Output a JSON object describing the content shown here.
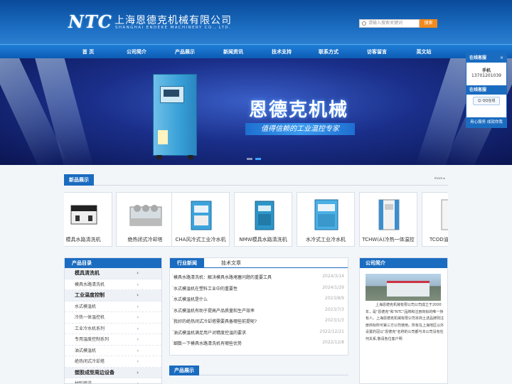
{
  "header": {
    "logo": "NTC",
    "company_cn": "上海恩德克机械有限公司",
    "company_en": "SHANGHAI ENDEKE MACHINERY CO., LTD.",
    "search_placeholder": "请输入搜索关键词",
    "search_button": "搜索"
  },
  "nav": [
    "首 页",
    "公司简介",
    "产品展示",
    "新闻资讯",
    "技术支持",
    "联系方式",
    "访客留言",
    "英文站"
  ],
  "banner": {
    "title": "恩德克机械",
    "subtitle": "值得信赖的工业温控专家"
  },
  "products_section": {
    "title": "新品展示",
    "more": "more ▸",
    "items": [
      "模具水路清洗机",
      "绝热闭式冷却塔",
      "CHA风冷式工业冷水机",
      "NMW模具水路清洗机",
      "水冷式工业冷水机",
      "TCHW(A)冷热一体温控",
      "TCOD油"
    ]
  },
  "sidebar": {
    "title": "产品目录",
    "items": [
      {
        "label": "模具清洗机",
        "cat": true
      },
      {
        "label": "模具水路清洗机",
        "cat": false
      },
      {
        "label": "工业温度控制",
        "cat": true
      },
      {
        "label": "水式模温机",
        "cat": false
      },
      {
        "label": "冷热一体温控机",
        "cat": false
      },
      {
        "label": "工业冷水机系列",
        "cat": false
      },
      {
        "label": "专用温度控制系列",
        "cat": false
      },
      {
        "label": "油式模温机",
        "cat": false
      },
      {
        "label": "绝热闭式冷却塔",
        "cat": false
      },
      {
        "label": "塑胶成型周边设备",
        "cat": true
      },
      {
        "label": "材料输送",
        "cat": false
      }
    ]
  },
  "news": {
    "tabs": [
      "行业新闻",
      "技术文章"
    ],
    "items": [
      {
        "title": "模具水路清洗机：解决模具水路堵塞问题的重要工具",
        "date": "2024/3/14"
      },
      {
        "title": "水式模温机在塑料工业中的重要性",
        "date": "2024/1/29"
      },
      {
        "title": "水式模温机是什么",
        "date": "2023/8/9"
      },
      {
        "title": "水式模温机有助于提高产品质量和生产效率",
        "date": "2023/7/3"
      },
      {
        "title": "我好的绝热闭式冷却塔需要具备哪些前提呢?",
        "date": "2023/1/3"
      },
      {
        "title": "油式模温机满足用户对精度控温的要求",
        "date": "2022/12/21"
      },
      {
        "title": "细数一下模具水路清洗机有哪些优势",
        "date": "2022/12/8"
      }
    ]
  },
  "about": {
    "title": "公司简介",
    "text": "上海恩德克机械有限公司公司成立于2000年，是\"恩德克\"和\"NTC\"品牌和注册商标的唯一持有人。上海恩德克机械有限公司本商土述品牌则注册商标所可第三方公司使用。所有在上海地区以外设置的冠以\"恩德克\"名称的公司都与本公司没有任何关系,敬请各位客户明"
  },
  "section2": {
    "title": "产品展示"
  },
  "float": {
    "title": "在线客服",
    "close": "×",
    "label": "手机",
    "phone": "13701201039",
    "qq": "QQ在线",
    "footer": "用心服务 成就你我"
  }
}
